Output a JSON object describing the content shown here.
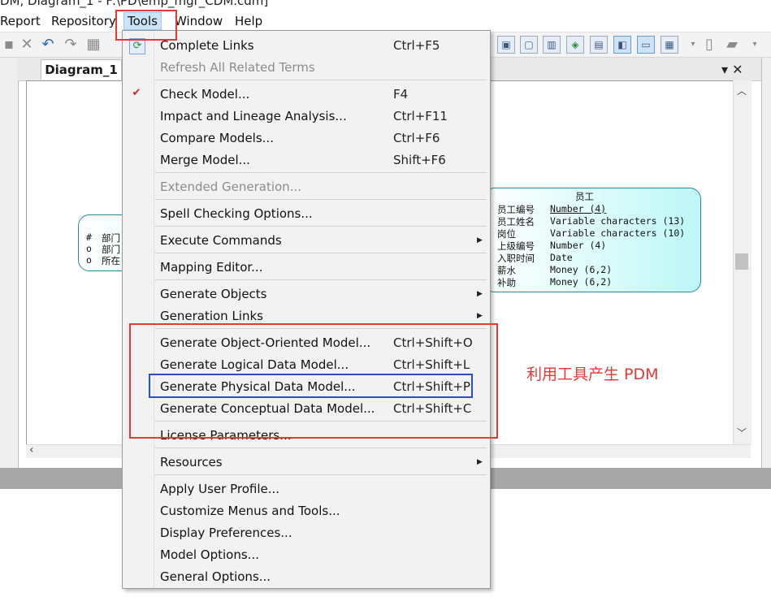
{
  "window_title": "DM, Diagram_1 - F:\\PD\\emp_mgr_CDM.cdm]",
  "menubar": {
    "report": "Report",
    "repository": "Repository",
    "tools": "Tools",
    "window": "Window",
    "help": "Help"
  },
  "tabs": {
    "diagram": "Diagram_1"
  },
  "pane_controls": "▾ ✕",
  "tools_menu": {
    "complete_links": {
      "label": "Complete Links",
      "shortcut": "Ctrl+F5"
    },
    "refresh_terms": {
      "label": "Refresh All Related Terms"
    },
    "check_model": {
      "label": "Check Model...",
      "shortcut": "F4"
    },
    "impact_analysis": {
      "label": "Impact and Lineage Analysis...",
      "shortcut": "Ctrl+F11"
    },
    "compare_models": {
      "label": "Compare Models...",
      "shortcut": "Ctrl+F6"
    },
    "merge_model": {
      "label": "Merge Model...",
      "shortcut": "Shift+F6"
    },
    "extended_generation": {
      "label": "Extended Generation..."
    },
    "spell_checking": {
      "label": "Spell Checking Options..."
    },
    "execute_commands": {
      "label": "Execute Commands"
    },
    "mapping_editor": {
      "label": "Mapping Editor..."
    },
    "generate_objects": {
      "label": "Generate Objects"
    },
    "generation_links": {
      "label": "Generation Links"
    },
    "gen_oom": {
      "label": "Generate Object-Oriented Model...",
      "shortcut": "Ctrl+Shift+O"
    },
    "gen_ldm": {
      "label": "Generate Logical Data Model...",
      "shortcut": "Ctrl+Shift+L"
    },
    "gen_pdm": {
      "label": "Generate Physical Data Model...",
      "shortcut": "Ctrl+Shift+P"
    },
    "gen_cdm": {
      "label": "Generate Conceptual Data Model...",
      "shortcut": "Ctrl+Shift+C"
    },
    "license_parameters": {
      "label": "License Parameters..."
    },
    "resources": {
      "label": "Resources"
    },
    "apply_user_profile": {
      "label": "Apply User Profile..."
    },
    "customize_menus": {
      "label": "Customize Menus and Tools..."
    },
    "display_preferences": {
      "label": "Display Preferences..."
    },
    "model_options": {
      "label": "Model Options..."
    },
    "general_options": {
      "label": "General Options..."
    }
  },
  "entity_emp": {
    "title": "员工",
    "rows": [
      {
        "name": "员工编号",
        "type": "Number (4)"
      },
      {
        "name": "员工姓名",
        "type": "Variable characters (13)"
      },
      {
        "name": "岗位",
        "type": "Variable characters (10)"
      },
      {
        "name": "上级编号",
        "type": "Number (4)"
      },
      {
        "name": "入职时间",
        "type": "Date"
      },
      {
        "name": "薪水",
        "type": "Money (6,2)"
      },
      {
        "name": "补助",
        "type": "Money (6,2)"
      }
    ]
  },
  "entity_dept": {
    "rows": [
      {
        "marker": "#",
        "name": "部门"
      },
      {
        "marker": "o",
        "name": "部门"
      },
      {
        "marker": "o",
        "name": "所在"
      }
    ]
  },
  "annotation": "利用工具产生 PDM",
  "colors": {
    "highlight_red": "#e53935",
    "highlight_blue": "#2d4fbf",
    "entity_fill": "#bdf7f7"
  }
}
